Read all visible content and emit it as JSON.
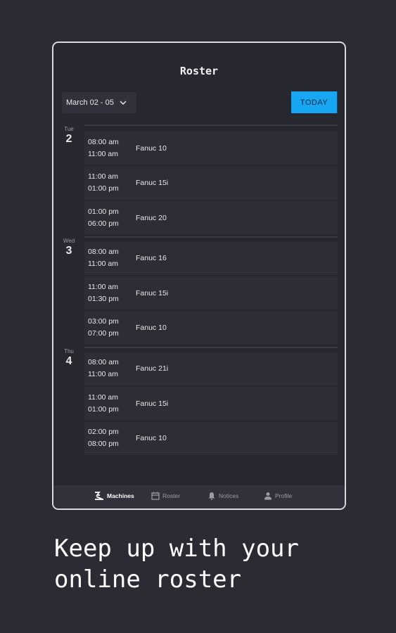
{
  "header": {
    "title": "Roster"
  },
  "toolbar": {
    "date_range": "March 02 - 05",
    "today_label": "TODAY"
  },
  "days": [
    {
      "dow": "Tue",
      "day": "2",
      "events": [
        {
          "start": "08:00 am",
          "end": "11:00 am",
          "machine": "Fanuc 10"
        },
        {
          "start": "11:00 am",
          "end": "01:00 pm",
          "machine": "Fanuc 15i"
        },
        {
          "start": "01:00 pm",
          "end": "06:00 pm",
          "machine": "Fanuc 20"
        }
      ]
    },
    {
      "dow": "Wed",
      "day": "3",
      "events": [
        {
          "start": "08:00 am",
          "end": "11:00 am",
          "machine": "Fanuc 16"
        },
        {
          "start": "11:00 am",
          "end": "01:30 pm",
          "machine": "Fanuc 15i"
        },
        {
          "start": "03:00 pm",
          "end": "07:00 pm",
          "machine": "Fanuc 10"
        }
      ]
    },
    {
      "dow": "Thu",
      "day": "4",
      "events": [
        {
          "start": "08:00 am",
          "end": "11:00 am",
          "machine": "Fanuc 21i"
        },
        {
          "start": "11:00 am",
          "end": "01:00 pm",
          "machine": "Fanuc 15i"
        },
        {
          "start": "02:00 pm",
          "end": "08:00 pm",
          "machine": "Fanuc 10"
        }
      ]
    }
  ],
  "nav": [
    {
      "label": "Machines",
      "icon": "machines-icon",
      "active": true
    },
    {
      "label": "Roster",
      "icon": "calendar-icon",
      "active": false
    },
    {
      "label": "Notices",
      "icon": "bell-icon",
      "active": false
    },
    {
      "label": "Profile",
      "icon": "person-icon",
      "active": false
    }
  ],
  "tagline": [
    "Keep up with your",
    "online roster"
  ],
  "colors": {
    "background": "#2a2b33",
    "accent": "#16a6f2",
    "card": "#2c2d35"
  }
}
